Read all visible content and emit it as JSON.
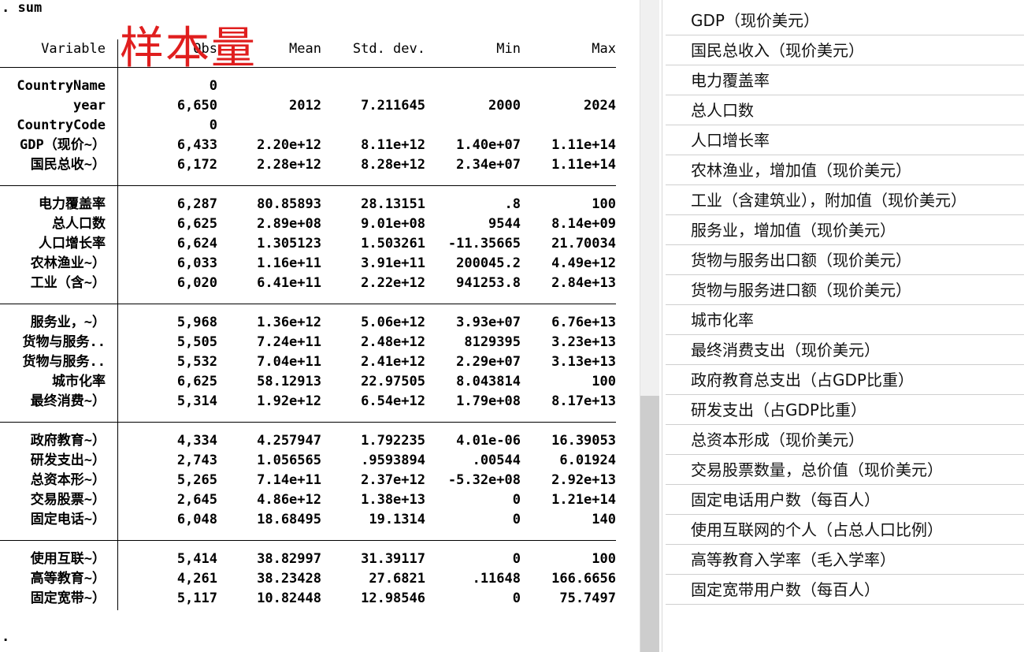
{
  "stata": {
    "command": ". sum",
    "prompt_end": ".",
    "annotation": "样本量",
    "headers": {
      "variable": "Variable",
      "obs": "Obs",
      "mean": "Mean",
      "sd": "Std. dev.",
      "min": "Min",
      "max": "Max"
    },
    "rows": [
      {
        "var": "CountryName",
        "obs": "0",
        "mean": "",
        "sd": "",
        "min": "",
        "max": ""
      },
      {
        "var": "year",
        "obs": "6,650",
        "mean": "2012",
        "sd": "7.211645",
        "min": "2000",
        "max": "2024"
      },
      {
        "var": "CountryCode",
        "obs": "0",
        "mean": "",
        "sd": "",
        "min": "",
        "max": ""
      },
      {
        "var": "GDP（现价~）",
        "obs": "6,433",
        "mean": "2.20e+12",
        "sd": "8.11e+12",
        "min": "1.40e+07",
        "max": "1.11e+14"
      },
      {
        "var": "国民总收~）",
        "obs": "6,172",
        "mean": "2.28e+12",
        "sd": "8.28e+12",
        "min": "2.34e+07",
        "max": "1.11e+14"
      },
      {
        "var": "电力覆盖率",
        "obs": "6,287",
        "mean": "80.85893",
        "sd": "28.13151",
        "min": ".8",
        "max": "100"
      },
      {
        "var": "总人口数",
        "obs": "6,625",
        "mean": "2.89e+08",
        "sd": "9.01e+08",
        "min": "9544",
        "max": "8.14e+09"
      },
      {
        "var": "人口增长率",
        "obs": "6,624",
        "mean": "1.305123",
        "sd": "1.503261",
        "min": "-11.35665",
        "max": "21.70034"
      },
      {
        "var": "农林渔业~）",
        "obs": "6,033",
        "mean": "1.16e+11",
        "sd": "3.91e+11",
        "min": "200045.2",
        "max": "4.49e+12"
      },
      {
        "var": "工业（含~）",
        "obs": "6,020",
        "mean": "6.41e+11",
        "sd": "2.22e+12",
        "min": "941253.8",
        "max": "2.84e+13"
      },
      {
        "var": "服务业，~）",
        "obs": "5,968",
        "mean": "1.36e+12",
        "sd": "5.06e+12",
        "min": "3.93e+07",
        "max": "6.76e+13"
      },
      {
        "var": "货物与服务..",
        "obs": "5,505",
        "mean": "7.24e+11",
        "sd": "2.48e+12",
        "min": "8129395",
        "max": "3.23e+13"
      },
      {
        "var": "货物与服务..",
        "obs": "5,532",
        "mean": "7.04e+11",
        "sd": "2.41e+12",
        "min": "2.29e+07",
        "max": "3.13e+13"
      },
      {
        "var": "城市化率",
        "obs": "6,625",
        "mean": "58.12913",
        "sd": "22.97505",
        "min": "8.043814",
        "max": "100"
      },
      {
        "var": "最终消费~）",
        "obs": "5,314",
        "mean": "1.92e+12",
        "sd": "6.54e+12",
        "min": "1.79e+08",
        "max": "8.17e+13"
      },
      {
        "var": "政府教育~）",
        "obs": "4,334",
        "mean": "4.257947",
        "sd": "1.792235",
        "min": "4.01e-06",
        "max": "16.39053"
      },
      {
        "var": "研发支出~）",
        "obs": "2,743",
        "mean": "1.056565",
        "sd": ".9593894",
        "min": ".00544",
        "max": "6.01924"
      },
      {
        "var": "总资本形~）",
        "obs": "5,265",
        "mean": "7.14e+11",
        "sd": "2.37e+12",
        "min": "-5.32e+08",
        "max": "2.92e+13"
      },
      {
        "var": "交易股票~）",
        "obs": "2,645",
        "mean": "4.86e+12",
        "sd": "1.38e+13",
        "min": "0",
        "max": "1.21e+14"
      },
      {
        "var": "固定电话~）",
        "obs": "6,048",
        "mean": "18.68495",
        "sd": "19.1314",
        "min": "0",
        "max": "140"
      },
      {
        "var": "使用互联~）",
        "obs": "5,414",
        "mean": "38.82997",
        "sd": "31.39117",
        "min": "0",
        "max": "100"
      },
      {
        "var": "高等教育~）",
        "obs": "4,261",
        "mean": "38.23428",
        "sd": "27.6821",
        "min": ".11648",
        "max": "166.6656"
      },
      {
        "var": "固定宽带~）",
        "obs": "5,117",
        "mean": "10.82448",
        "sd": "12.98546",
        "min": "0",
        "max": "75.7497"
      }
    ]
  },
  "variable_list": [
    "GDP（现价美元）",
    "国民总收入（现价美元）",
    "电力覆盖率",
    "总人口数",
    "人口增长率",
    "农林渔业，增加值（现价美元）",
    "工业（含建筑业），附加值（现价美元）",
    "服务业，增加值（现价美元）",
    "货物与服务出口额（现价美元）",
    "货物与服务进口额（现价美元）",
    "城市化率",
    "最终消费支出（现价美元）",
    "政府教育总支出（占GDP比重）",
    "研发支出（占GDP比重）",
    "总资本形成（现价美元）",
    "交易股票数量，总价值（现价美元）",
    "固定电话用户数（每百人）",
    "使用互联网的个人（占总人口比例）",
    "高等教育入学率（毛入学率）",
    "固定宽带用户数（每百人）"
  ],
  "colors": {
    "annotation": "#e01e1e",
    "scroll_thumb": "#cdcdcd"
  }
}
